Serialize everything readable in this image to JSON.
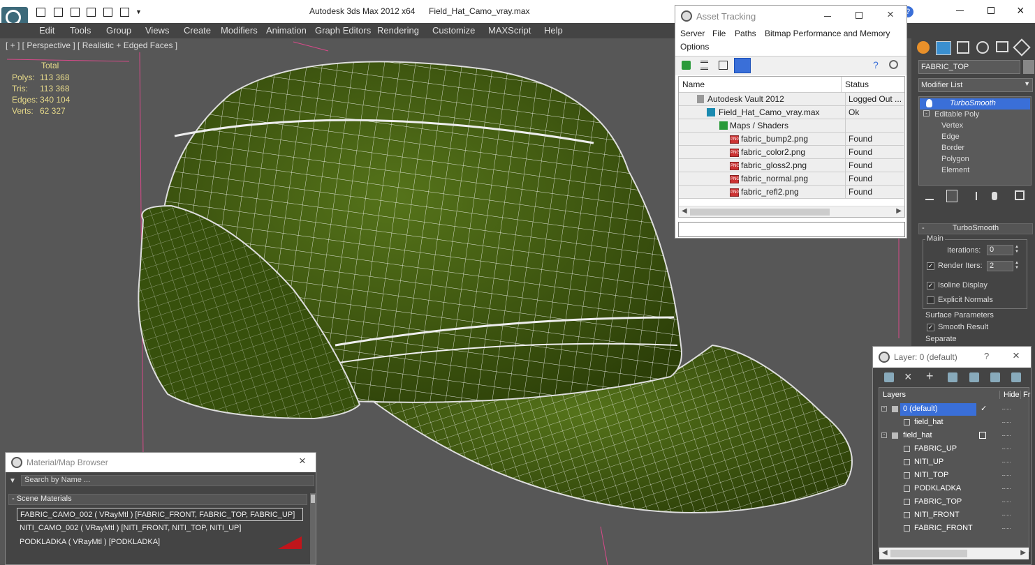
{
  "titlebar": {
    "app_title": "Autodesk 3ds Max  2012 x64",
    "file_name": "Field_Hat_Camo_vray.max"
  },
  "menu": [
    "Edit",
    "Tools",
    "Group",
    "Views",
    "Create",
    "Modifiers",
    "Animation",
    "Graph Editors",
    "Rendering",
    "Customize",
    "MAXScript",
    "Help"
  ],
  "viewport": {
    "label": "[ + ] [ Perspective ] [ Realistic + Edged Faces ]",
    "stats": {
      "header": "Total",
      "rows": [
        {
          "label": "Polys:",
          "value": "113 368"
        },
        {
          "label": "Tris:",
          "value": "113 368"
        },
        {
          "label": "Edges:",
          "value": "340 104"
        },
        {
          "label": "Verts:",
          "value": "62 327"
        }
      ]
    }
  },
  "asset_tracking": {
    "title": "Asset Tracking",
    "menu": [
      "Server",
      "File",
      "Paths",
      "Bitmap Performance and Memory",
      "Options"
    ],
    "col_name": "Name",
    "col_status": "Status",
    "rows": [
      {
        "name": "Autodesk Vault 2012",
        "status": "Logged Out ..."
      },
      {
        "name": "Field_Hat_Camo_vray.max",
        "status": "Ok"
      },
      {
        "name": "Maps / Shaders",
        "status": ""
      },
      {
        "name": "fabric_bump2.png",
        "status": "Found"
      },
      {
        "name": "fabric_color2.png",
        "status": "Found"
      },
      {
        "name": "fabric_gloss2.png",
        "status": "Found"
      },
      {
        "name": "fabric_normal.png",
        "status": "Found"
      },
      {
        "name": "fabric_refl2.png",
        "status": "Found"
      }
    ],
    "png_badge": "PNG"
  },
  "command_panel": {
    "object_name": "FABRIC_TOP",
    "modifier_list": "Modifier List",
    "stack": [
      "TurboSmooth",
      "Editable Poly",
      "Vertex",
      "Edge",
      "Border",
      "Polygon",
      "Element"
    ],
    "rollout_title": "TurboSmooth",
    "main_group": "Main",
    "iterations_label": "Iterations:",
    "iterations_value": "0",
    "render_iters_label": "Render Iters:",
    "render_iters_value": "2",
    "isoline_label": "Isoline Display",
    "explicit_label": "Explicit Normals",
    "surface_group": "Surface Parameters",
    "smooth_label": "Smooth Result",
    "separate_label": "Separate"
  },
  "layer_dialog": {
    "title": "Layer: 0 (default)",
    "col_layers": "Layers",
    "col_hide": "Hide",
    "col_fr": "Fr",
    "rows": [
      {
        "name": "0 (default)",
        "level": 0
      },
      {
        "name": "field_hat",
        "level": 1
      },
      {
        "name": "field_hat",
        "level": 0
      },
      {
        "name": "FABRIC_UP",
        "level": 1
      },
      {
        "name": "NITI_UP",
        "level": 1
      },
      {
        "name": "NITI_TOP",
        "level": 1
      },
      {
        "name": "PODKLADKA",
        "level": 1
      },
      {
        "name": "FABRIC_TOP",
        "level": 1
      },
      {
        "name": "NITI_FRONT",
        "level": 1
      },
      {
        "name": "FABRIC_FRONT",
        "level": 1
      }
    ]
  },
  "material_browser": {
    "title": "Material/Map Browser",
    "search_placeholder": "Search by Name ...",
    "section": "- Scene Materials",
    "items": [
      "FABRIC_CAMO_002  ( VRayMtl )  [FABRIC_FRONT, FABRIC_TOP, FABRIC_UP]",
      "NITI_CAMO_002  ( VRayMtl )  [NITI_FRONT, NITI_TOP, NITI_UP]",
      "PODKLADKA  ( VRayMtl )  [PODKLADKA]"
    ]
  },
  "colors": {
    "accent": "#3a6fd8",
    "hat_green": "#3f5a0f",
    "stats_text": "#e6d98a"
  }
}
